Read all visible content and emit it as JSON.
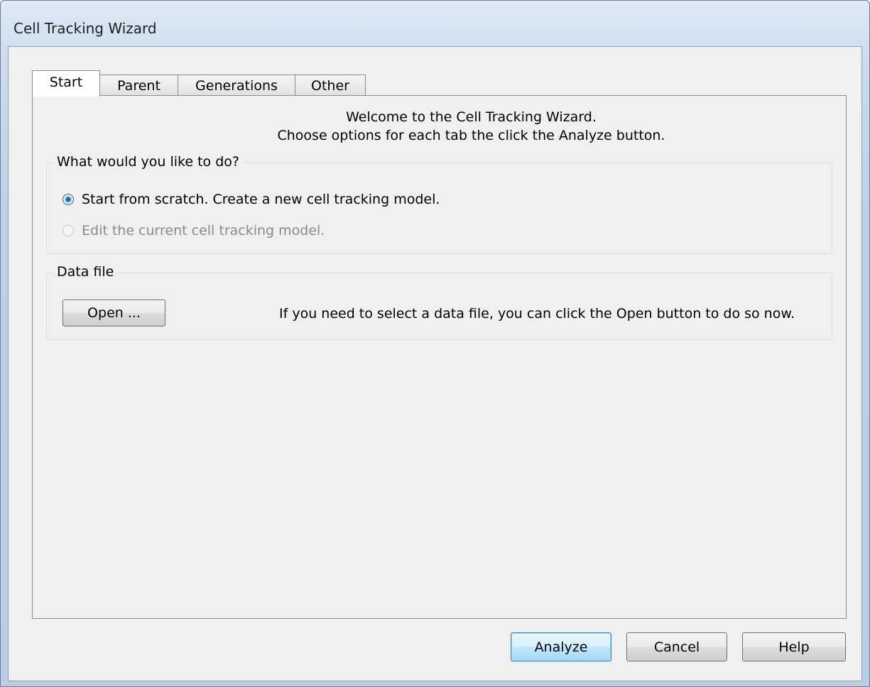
{
  "window": {
    "title": "Cell Tracking Wizard"
  },
  "tabs": [
    {
      "label": "Start",
      "active": true
    },
    {
      "label": "Parent",
      "active": false
    },
    {
      "label": "Generations",
      "active": false
    },
    {
      "label": "Other",
      "active": false
    }
  ],
  "start_tab": {
    "welcome_line1": "Welcome to the Cell Tracking Wizard.",
    "welcome_line2": "Choose options for each tab the click the Analyze button.",
    "action_group": {
      "title": "What would you like to do?",
      "options": [
        {
          "label": "Start from scratch.  Create a new cell tracking model.",
          "checked": true,
          "enabled": true
        },
        {
          "label": "Edit the current cell tracking model.",
          "checked": false,
          "enabled": false
        }
      ]
    },
    "data_file_group": {
      "title": "Data file",
      "open_button": "Open ...",
      "hint": "If you need to select a data file, you can click the Open button to do so now."
    }
  },
  "footer": {
    "analyze_button": "Analyze",
    "cancel_button": "Cancel",
    "help_button": "Help"
  }
}
